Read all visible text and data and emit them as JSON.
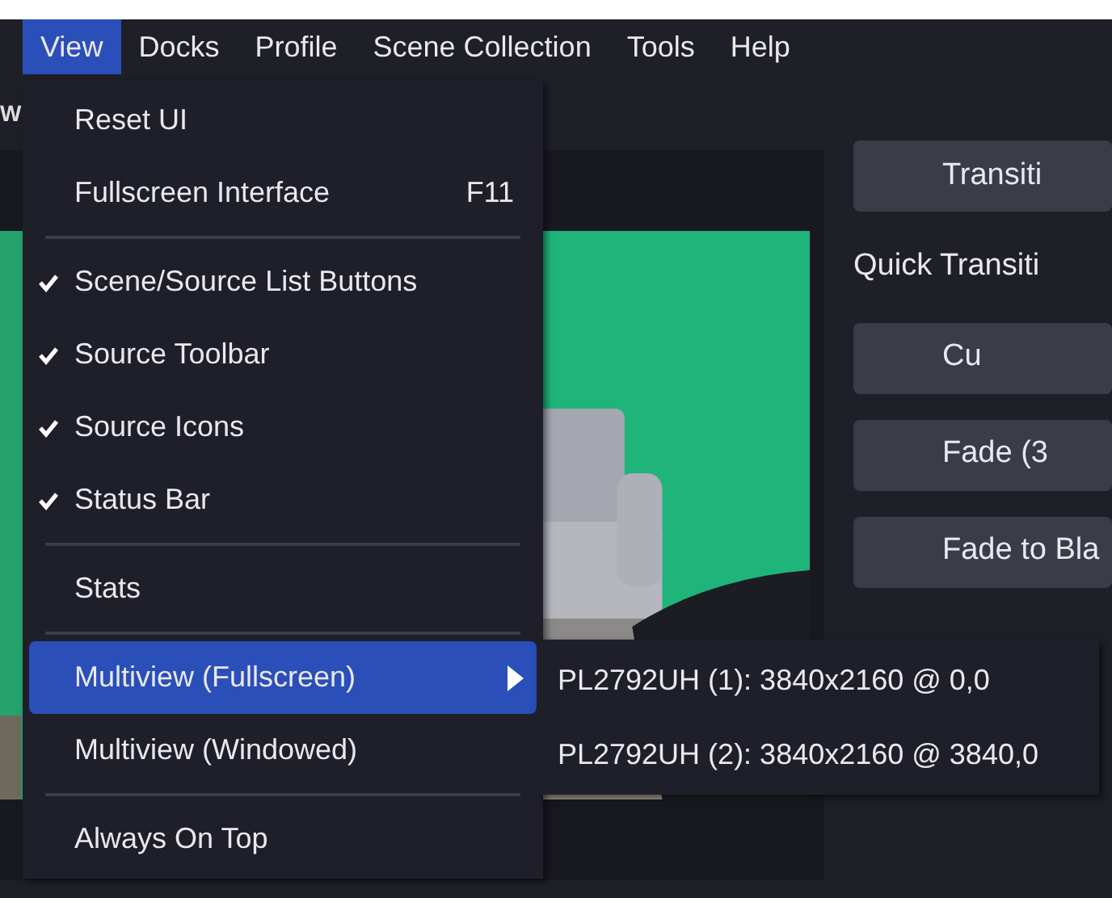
{
  "menu_bar": [
    {
      "label": "View",
      "selected": true
    },
    {
      "label": "Docks",
      "selected": false
    },
    {
      "label": "Profile",
      "selected": false
    },
    {
      "label": "Scene Collection",
      "selected": false
    },
    {
      "label": "Tools",
      "selected": false
    },
    {
      "label": "Help",
      "selected": false
    }
  ],
  "dock_title": "W",
  "controls": {
    "items": [
      {
        "kind": "button",
        "label": "Transiti"
      },
      {
        "kind": "label",
        "label": "Quick Transiti"
      },
      {
        "kind": "button",
        "label": "Cu"
      },
      {
        "kind": "button",
        "label": "Fade (3"
      },
      {
        "kind": "button",
        "label": "Fade to Bla"
      }
    ]
  },
  "view_menu": {
    "items": [
      {
        "kind": "item",
        "label": "Reset UI"
      },
      {
        "kind": "item",
        "label": "Fullscreen Interface",
        "shortcut": "F11"
      },
      {
        "kind": "separator"
      },
      {
        "kind": "check",
        "label": "Scene/Source List Buttons",
        "checked": true
      },
      {
        "kind": "check",
        "label": "Source Toolbar",
        "checked": true
      },
      {
        "kind": "check",
        "label": "Source Icons",
        "checked": true
      },
      {
        "kind": "check",
        "label": "Status Bar",
        "checked": true
      },
      {
        "kind": "separator"
      },
      {
        "kind": "item",
        "label": "Stats"
      },
      {
        "kind": "separator"
      },
      {
        "kind": "submenu",
        "label": "Multiview (Fullscreen)",
        "selected": true
      },
      {
        "kind": "item",
        "label": "Multiview (Windowed)",
        "selected": false
      },
      {
        "kind": "separator"
      },
      {
        "kind": "item",
        "label": "Always On Top"
      }
    ]
  },
  "submenu": {
    "items": [
      {
        "label": "PL2792UH (1): 3840x2160 @ 0,0"
      },
      {
        "label": "PL2792UH (2): 3840x2160 @ 3840,0"
      }
    ]
  }
}
